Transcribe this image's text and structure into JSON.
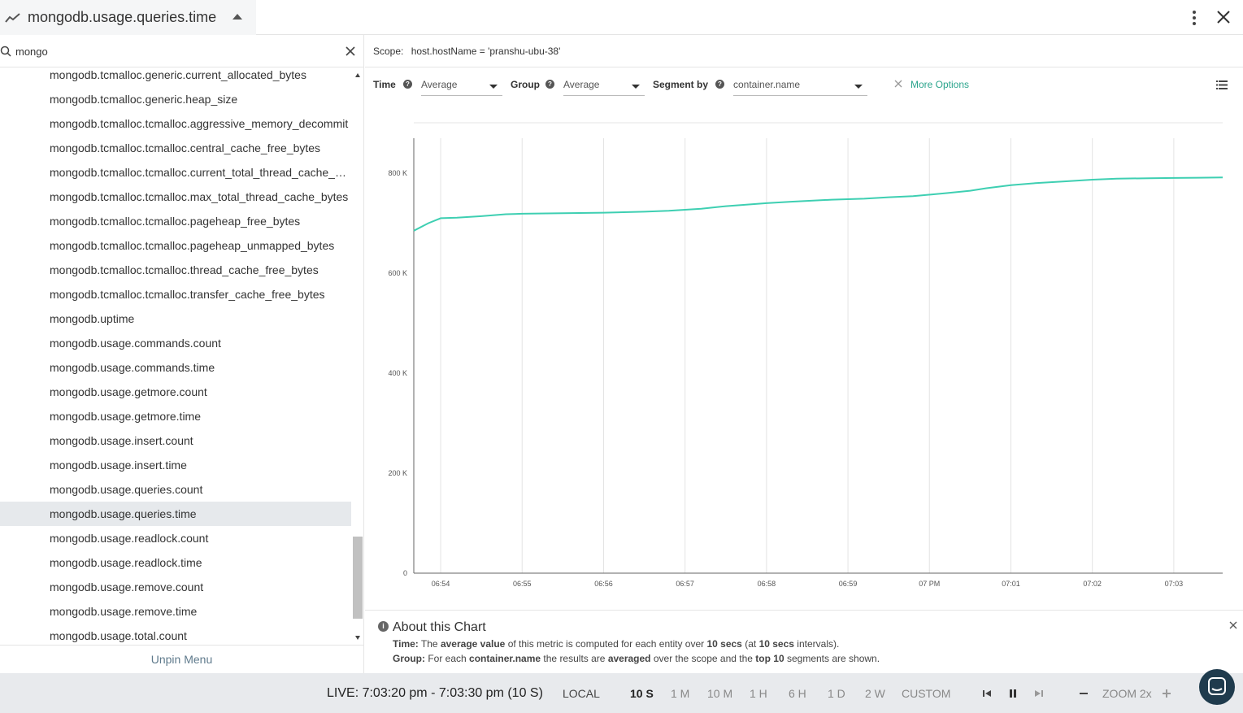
{
  "header": {
    "title": "mongodb.usage.queries.time"
  },
  "search": {
    "value": "mongo"
  },
  "metrics": [
    "mongodb.tcmalloc.generic.current_allocated_bytes",
    "mongodb.tcmalloc.generic.heap_size",
    "mongodb.tcmalloc.tcmalloc.aggressive_memory_decommit",
    "mongodb.tcmalloc.tcmalloc.central_cache_free_bytes",
    "mongodb.tcmalloc.tcmalloc.current_total_thread_cache_by…",
    "mongodb.tcmalloc.tcmalloc.max_total_thread_cache_bytes",
    "mongodb.tcmalloc.tcmalloc.pageheap_free_bytes",
    "mongodb.tcmalloc.tcmalloc.pageheap_unmapped_bytes",
    "mongodb.tcmalloc.tcmalloc.thread_cache_free_bytes",
    "mongodb.tcmalloc.tcmalloc.transfer_cache_free_bytes",
    "mongodb.uptime",
    "mongodb.usage.commands.count",
    "mongodb.usage.commands.time",
    "mongodb.usage.getmore.count",
    "mongodb.usage.getmore.time",
    "mongodb.usage.insert.count",
    "mongodb.usage.insert.time",
    "mongodb.usage.queries.count",
    "mongodb.usage.queries.time",
    "mongodb.usage.readlock.count",
    "mongodb.usage.readlock.time",
    "mongodb.usage.remove.count",
    "mongodb.usage.remove.time",
    "mongodb.usage.total.count"
  ],
  "selected_metric": "mongodb.usage.queries.time",
  "sidebar": {
    "unpin_label": "Unpin Menu"
  },
  "scope": {
    "label": "Scope:",
    "value": "host.hostName = 'pranshu-ubu-38'"
  },
  "controls": {
    "time_label": "Time",
    "time_value": "Average",
    "group_label": "Group",
    "group_value": "Average",
    "segment_label": "Segment by",
    "segment_value": "container.name",
    "more_options": "More Options"
  },
  "chart_data": {
    "type": "line",
    "series_color": "#3ecfb2",
    "x_tick_labels": [
      "06:54",
      "06:55",
      "06:56",
      "06:57",
      "06:58",
      "06:59",
      "07 PM",
      "07:01",
      "07:02",
      "07:03"
    ],
    "y_tick_labels": [
      "0",
      "200 K",
      "400 K",
      "600 K",
      "800 K"
    ],
    "y_ticks": [
      0,
      200000,
      400000,
      600000,
      800000
    ],
    "ylim": [
      0,
      870000
    ],
    "xlim_minutes": [
      6.67,
      16.6
    ],
    "grid": "vertical",
    "series": [
      {
        "x": [
          6.67,
          6.85,
          7.0,
          7.2,
          7.5,
          7.8,
          8.0,
          8.5,
          9.0,
          9.5,
          9.8,
          10.2,
          10.5,
          11.0,
          11.3,
          11.8,
          12.2,
          12.5,
          12.8,
          13.2,
          13.5,
          13.7,
          14.0,
          14.3,
          14.7,
          15.0,
          15.3,
          15.7,
          16.0,
          16.3,
          16.6
        ],
        "y": [
          685000,
          700000,
          710000,
          711000,
          714000,
          718000,
          719000,
          720000,
          721000,
          723000,
          725000,
          729000,
          734000,
          740000,
          743000,
          747000,
          749000,
          752000,
          754000,
          760000,
          765000,
          770000,
          776000,
          780000,
          784000,
          787000,
          789000,
          790000,
          790500,
          791000,
          791500
        ]
      }
    ]
  },
  "about": {
    "title": "About this Chart",
    "time_label": "Time:",
    "time_text_1": "The",
    "time_bold_1": "average value",
    "time_text_2": "of this metric is computed for each entity over",
    "time_bold_2": "10 secs",
    "time_text_3": "(at",
    "time_bold_3": "10 secs",
    "time_text_4": "intervals).",
    "group_label": "Group:",
    "group_text_1": "For each",
    "group_bold_1": "container.name",
    "group_text_2": "the results are",
    "group_bold_2": "averaged",
    "group_text_3": "over the scope and the",
    "group_bold_3": "top 10",
    "group_text_4": "segments are shown."
  },
  "footer": {
    "live": "LIVE: 7:03:20 pm - 7:03:30 pm (10 S)",
    "local": "LOCAL",
    "ranges": [
      "10 S",
      "1 M",
      "10 M",
      "1 H",
      "6 H",
      "1 D",
      "2 W",
      "CUSTOM"
    ],
    "active_range": "10 S",
    "zoom": "ZOOM 2x"
  }
}
